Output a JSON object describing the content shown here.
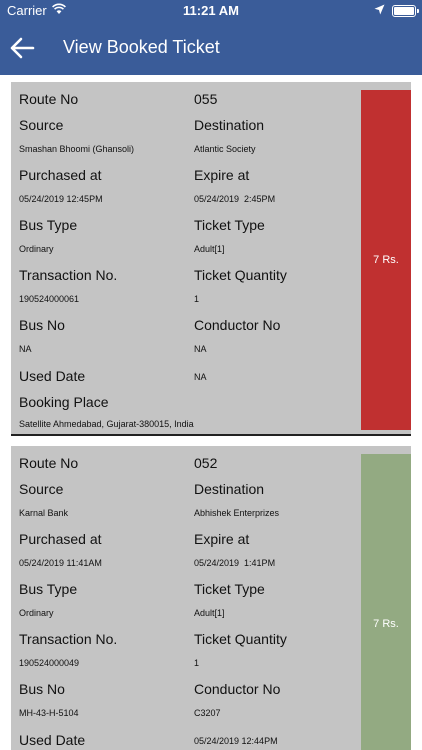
{
  "status_bar": {
    "carrier": "Carrier",
    "time": "11:21 AM"
  },
  "header": {
    "title": "View Booked Ticket"
  },
  "labels": {
    "route_no": "Route No",
    "source": "Source",
    "destination": "Destination",
    "purchased_at": "Purchased at",
    "expire_at": "Expire at",
    "bus_type": "Bus Type",
    "ticket_type": "Ticket Type",
    "transaction_no": "Transaction No.",
    "ticket_quantity": "Ticket Quantity",
    "bus_no": "Bus No",
    "conductor_no": "Conductor No",
    "used_date": "Used Date",
    "booking_place": "Booking Place"
  },
  "tickets": [
    {
      "route_no": "055",
      "source": "Smashan Bhoomi (Ghansoli)",
      "destination": "Atlantic Society",
      "purchased_at": "05/24/2019 12:45PM",
      "expire_at": "05/24/2019  2:45PM",
      "bus_type": "Ordinary",
      "ticket_type": "Adult[1]",
      "transaction_no": "190524000061",
      "ticket_quantity": "1",
      "bus_no": "NA",
      "conductor_no": "NA",
      "used_date": "NA",
      "booking_place": "Satellite Ahmedabad, Gujarat-380015, India",
      "amount": "7 Rs.",
      "status_color": "#c03030"
    },
    {
      "route_no": "052",
      "source": "Karnal Bank",
      "destination": "Abhishek Enterprizes",
      "purchased_at": "05/24/2019 11:41AM",
      "expire_at": "05/24/2019  1:41PM",
      "bus_type": "Ordinary",
      "ticket_type": "Adult[1]",
      "transaction_no": "190524000049",
      "ticket_quantity": "1",
      "bus_no": "MH-43-H-5104",
      "conductor_no": "C3207",
      "used_date": "05/24/2019 12:44PM",
      "amount": "7 Rs.",
      "status_color": "#93aa82"
    }
  ]
}
